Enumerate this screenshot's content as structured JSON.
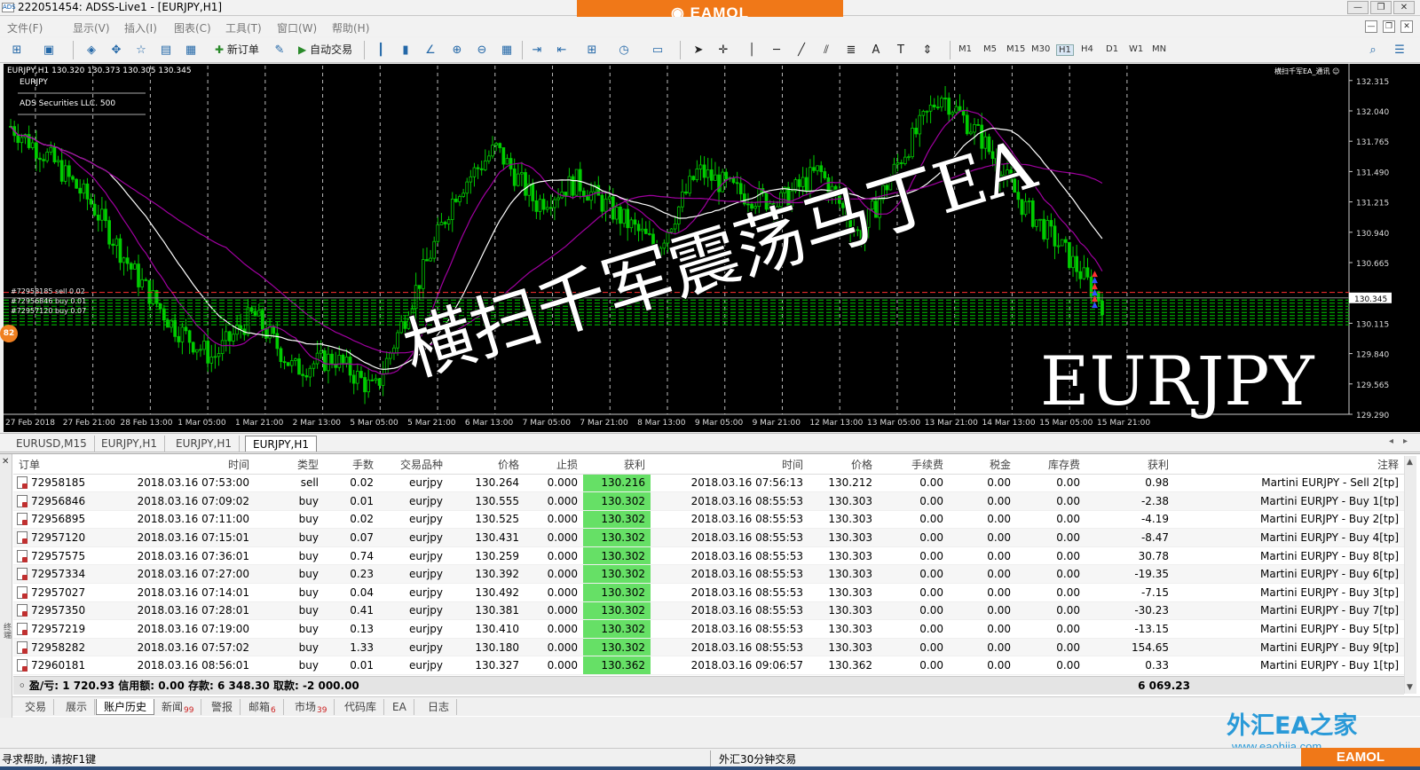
{
  "window": {
    "title": "222051454: ADSS-Live1 - [EURJPY,H1]",
    "app_logo": "ADS",
    "controls": [
      "—",
      "❐",
      "✕"
    ]
  },
  "banner": {
    "brand": "EAMOL",
    "brand_color": "#f07818"
  },
  "menu": {
    "items": [
      "文件(F)",
      "显示(V)",
      "插入(I)",
      "图表(C)",
      "工具(T)",
      "窗口(W)",
      "帮助(H)"
    ],
    "right_controls": [
      "—",
      "❐",
      "✕"
    ]
  },
  "toolbar": {
    "new_order_label": "新订单",
    "auto_trading_label": "自动交易",
    "timeframes": [
      "M1",
      "M5",
      "M15",
      "M30",
      "H1",
      "H4",
      "D1",
      "W1",
      "MN"
    ]
  },
  "chart": {
    "header": "EURJPY,H1  130.320 130.373 130.305 130.345",
    "symbol_label": "EURJPY",
    "broker_label": "ADS Securities LLC.  500",
    "ea_label": "横扫千军EA_通讯 ☺",
    "overlay_title": "横扫千军震荡马丁EA",
    "overlay_symbol": "EURJPY",
    "price_pin": "82",
    "current_price": "130.345",
    "order_tags": [
      "#72958185 sell 0.02",
      "#72956846 buy 0.01",
      "#72957120 buy 0.07"
    ],
    "colors": {
      "bull": "#00cc00",
      "bear": "#00cc00",
      "ma_fast": "#a000a0",
      "ma_slow": "#ffffff",
      "order_line": "#00cc00",
      "stop_line": "#ff3030",
      "bg": "#000000"
    }
  },
  "chart_data": {
    "type": "candlestick",
    "symbol": "EURJPY",
    "timeframe": "H1",
    "y_ticks": [
      "132.315",
      "132.040",
      "131.765",
      "131.490",
      "131.215",
      "130.940",
      "130.665",
      "130.345",
      "130.115",
      "129.840",
      "129.565",
      "129.290"
    ],
    "x_ticks": [
      "27 Feb 2018",
      "27 Feb 21:00",
      "28 Feb 13:00",
      "1 Mar 05:00",
      "1 Mar 21:00",
      "2 Mar 13:00",
      "5 Mar 05:00",
      "5 Mar 21:00",
      "6 Mar 13:00",
      "7 Mar 05:00",
      "7 Mar 21:00",
      "8 Mar 13:00",
      "9 Mar 05:00",
      "9 Mar 21:00",
      "12 Mar 13:00",
      "13 Mar 05:00",
      "13 Mar 21:00",
      "14 Mar 13:00",
      "15 Mar 05:00",
      "15 Mar 21:00"
    ],
    "ylim": [
      129.29,
      132.45
    ],
    "close_trend": [
      131.9,
      131.6,
      131.2,
      130.6,
      130.1,
      129.8,
      130.2,
      129.7,
      129.8,
      129.5,
      130.4,
      131.3,
      131.7,
      131.2,
      131.4,
      131.1,
      130.8,
      131.5,
      131.3,
      131.2,
      131.5,
      130.9,
      131.6,
      132.2,
      131.8,
      131.2,
      130.8,
      130.3
    ]
  },
  "chart_tabs": [
    "EURUSD,M15",
    "EURJPY,H1",
    "EURJPY,H1",
    "EURJPY,H1"
  ],
  "table": {
    "columns": [
      "订单",
      "时间",
      "类型",
      "手数",
      "交易品种",
      "价格",
      "止损",
      "获利",
      "时间",
      "价格",
      "手续费",
      "税金",
      "库存费",
      "获利",
      "注释"
    ],
    "rows": [
      [
        "72958185",
        "2018.03.16 07:53:00",
        "sell",
        "0.02",
        "eurjpy",
        "130.264",
        "0.000",
        "130.216",
        "2018.03.16 07:56:13",
        "130.212",
        "0.00",
        "0.00",
        "0.00",
        "0.98",
        "Martini EURJPY - Sell 2[tp]"
      ],
      [
        "72956846",
        "2018.03.16 07:09:02",
        "buy",
        "0.01",
        "eurjpy",
        "130.555",
        "0.000",
        "130.302",
        "2018.03.16 08:55:53",
        "130.303",
        "0.00",
        "0.00",
        "0.00",
        "-2.38",
        "Martini EURJPY - Buy 1[tp]"
      ],
      [
        "72956895",
        "2018.03.16 07:11:00",
        "buy",
        "0.02",
        "eurjpy",
        "130.525",
        "0.000",
        "130.302",
        "2018.03.16 08:55:53",
        "130.303",
        "0.00",
        "0.00",
        "0.00",
        "-4.19",
        "Martini EURJPY - Buy 2[tp]"
      ],
      [
        "72957120",
        "2018.03.16 07:15:01",
        "buy",
        "0.07",
        "eurjpy",
        "130.431",
        "0.000",
        "130.302",
        "2018.03.16 08:55:53",
        "130.303",
        "0.00",
        "0.00",
        "0.00",
        "-8.47",
        "Martini EURJPY - Buy 4[tp]"
      ],
      [
        "72957575",
        "2018.03.16 07:36:01",
        "buy",
        "0.74",
        "eurjpy",
        "130.259",
        "0.000",
        "130.302",
        "2018.03.16 08:55:53",
        "130.303",
        "0.00",
        "0.00",
        "0.00",
        "30.78",
        "Martini EURJPY - Buy 8[tp]"
      ],
      [
        "72957334",
        "2018.03.16 07:27:00",
        "buy",
        "0.23",
        "eurjpy",
        "130.392",
        "0.000",
        "130.302",
        "2018.03.16 08:55:53",
        "130.303",
        "0.00",
        "0.00",
        "0.00",
        "-19.35",
        "Martini EURJPY - Buy 6[tp]"
      ],
      [
        "72957027",
        "2018.03.16 07:14:01",
        "buy",
        "0.04",
        "eurjpy",
        "130.492",
        "0.000",
        "130.302",
        "2018.03.16 08:55:53",
        "130.303",
        "0.00",
        "0.00",
        "0.00",
        "-7.15",
        "Martini EURJPY - Buy 3[tp]"
      ],
      [
        "72957350",
        "2018.03.16 07:28:01",
        "buy",
        "0.41",
        "eurjpy",
        "130.381",
        "0.000",
        "130.302",
        "2018.03.16 08:55:53",
        "130.303",
        "0.00",
        "0.00",
        "0.00",
        "-30.23",
        "Martini EURJPY - Buy 7[tp]"
      ],
      [
        "72957219",
        "2018.03.16 07:19:00",
        "buy",
        "0.13",
        "eurjpy",
        "130.410",
        "0.000",
        "130.302",
        "2018.03.16 08:55:53",
        "130.303",
        "0.00",
        "0.00",
        "0.00",
        "-13.15",
        "Martini EURJPY - Buy 5[tp]"
      ],
      [
        "72958282",
        "2018.03.16 07:57:02",
        "buy",
        "1.33",
        "eurjpy",
        "130.180",
        "0.000",
        "130.302",
        "2018.03.16 08:55:53",
        "130.303",
        "0.00",
        "0.00",
        "0.00",
        "154.65",
        "Martini EURJPY - Buy 9[tp]"
      ],
      [
        "72960181",
        "2018.03.16 08:56:01",
        "buy",
        "0.01",
        "eurjpy",
        "130.327",
        "0.000",
        "130.362",
        "2018.03.16 09:06:57",
        "130.362",
        "0.00",
        "0.00",
        "0.00",
        "0.33",
        "Martini EURJPY - Buy 1[tp]"
      ]
    ],
    "tp_highlight_color": "#66e066"
  },
  "summary": {
    "text": "盈/亏: 1 720.93  信用额: 0.00  存款: 6 348.30  取款: -2 000.00",
    "total_profit": "6 069.23"
  },
  "terminal_tabs": [
    {
      "label": "交易",
      "count": ""
    },
    {
      "label": "展示",
      "count": ""
    },
    {
      "label": "账户历史",
      "count": ""
    },
    {
      "label": "新闻",
      "count": "99"
    },
    {
      "label": "警报",
      "count": ""
    },
    {
      "label": "邮箱",
      "count": "6"
    },
    {
      "label": "市场",
      "count": "39"
    },
    {
      "label": "代码库",
      "count": ""
    },
    {
      "label": "EA",
      "count": ""
    },
    {
      "label": "日志",
      "count": ""
    }
  ],
  "terminal_side_label": "终端",
  "status": {
    "help": "寻求帮助, 请按F1键",
    "profile": "外汇30分钟交易"
  },
  "watermark": {
    "fx_home": "外汇EA之家",
    "url": "www.eaohjia.com",
    "eamol": "EAMOL"
  }
}
